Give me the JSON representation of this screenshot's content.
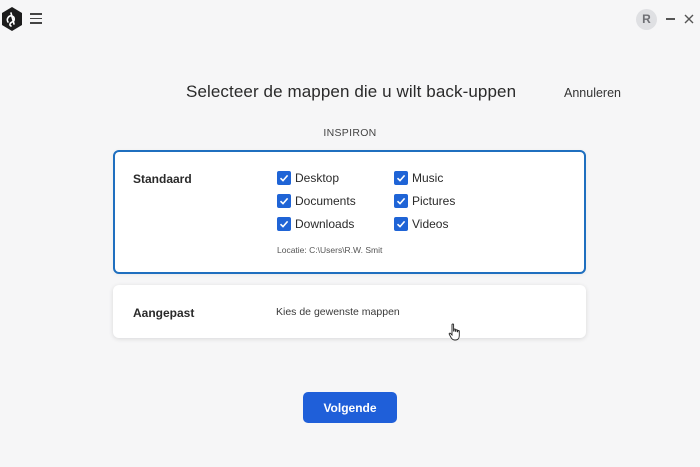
{
  "titlebar": {
    "avatar_initial": "R"
  },
  "header": {
    "title": "Selecteer de mappen die u wilt back-uppen",
    "cancel_label": "Annuleren",
    "device_name": "INSPIRON"
  },
  "standard": {
    "label": "Standaard",
    "folders": [
      {
        "label": "Desktop",
        "checked": true
      },
      {
        "label": "Documents",
        "checked": true
      },
      {
        "label": "Downloads",
        "checked": true
      },
      {
        "label": "Music",
        "checked": true
      },
      {
        "label": "Pictures",
        "checked": true
      },
      {
        "label": "Videos",
        "checked": true
      }
    ],
    "location": "Locatie: C:\\Users\\R.W. Smit"
  },
  "custom": {
    "label": "Aangepast",
    "hint": "Kies de gewenste mappen"
  },
  "footer": {
    "next_label": "Volgende"
  },
  "colors": {
    "accent": "#1f5fd9",
    "selected_border": "#1f6fbf",
    "background": "#f6f6f7"
  },
  "icons": [
    "app-logo-icon",
    "menu-icon",
    "minimize-icon",
    "close-icon",
    "checkbox-checked-icon",
    "mouse-cursor-icon"
  ]
}
